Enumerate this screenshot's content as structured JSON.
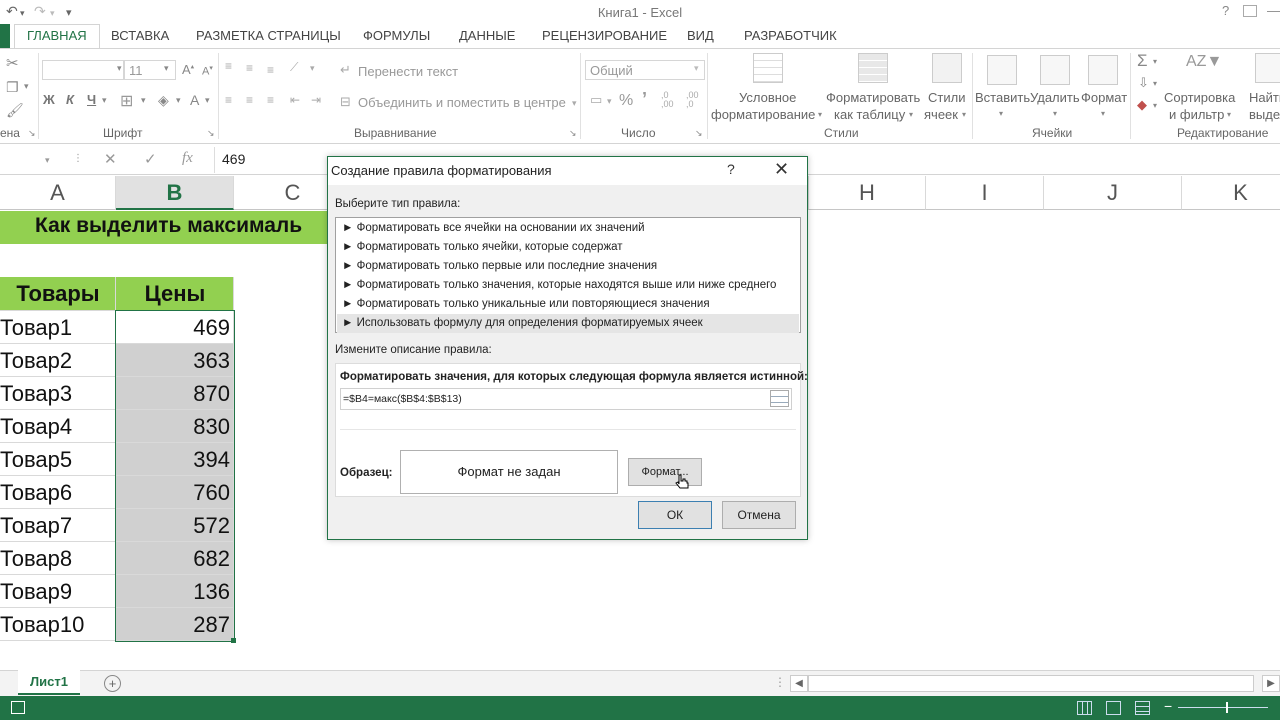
{
  "window": {
    "title": "Книга1 - Excel",
    "help": "?"
  },
  "tabs": [
    "ГЛАВНАЯ",
    "ВСТАВКА",
    "РАЗМЕТКА СТРАНИЦЫ",
    "ФОРМУЛЫ",
    "ДАННЫЕ",
    "РЕЦЕНЗИРОВАНИЕ",
    "ВИД",
    "РАЗРАБОТЧИК"
  ],
  "ribbon": {
    "font_size": "11",
    "bold": "Ж",
    "italic": "К",
    "underline": "Ч",
    "wrap_text": "Перенести текст",
    "merge_center": "Объединить и поместить в центре",
    "number_format": "Общий",
    "percent": "%",
    "comma": "’",
    "conditional_l1": "Условное",
    "conditional_l2": "форматирование",
    "format_table_l1": "Форматировать",
    "format_table_l2": "как таблицу",
    "styles_l1": "Стили",
    "styles_l2": "ячеек",
    "insert": "Вставить",
    "delete": "Удалить",
    "format": "Формат",
    "sort_l1": "Сортировка",
    "sort_l2": "и фильтр",
    "find_l1": "Найти",
    "find_l2": "выдел",
    "groups": {
      "clipboard": "ена",
      "font": "Шрифт",
      "alignment": "Выравнивание",
      "number": "Число",
      "styles": "Стили",
      "cells": "Ячейки",
      "editing": "Редактирование"
    }
  },
  "formula_bar": {
    "fx": "fx",
    "value": "469"
  },
  "columns": [
    "A",
    "B",
    "C",
    "H",
    "I",
    "J",
    "K"
  ],
  "sheet": {
    "title": "Как выделить максималь",
    "header_goods": "Товары",
    "header_prices": "Цены",
    "rows": [
      {
        "name": "Товар1",
        "price": "469"
      },
      {
        "name": "Товар2",
        "price": "363"
      },
      {
        "name": "Товар3",
        "price": "870"
      },
      {
        "name": "Товар4",
        "price": "830"
      },
      {
        "name": "Товар5",
        "price": "394"
      },
      {
        "name": "Товар6",
        "price": "760"
      },
      {
        "name": "Товар7",
        "price": "572"
      },
      {
        "name": "Товар8",
        "price": "682"
      },
      {
        "name": "Товар9",
        "price": "136"
      },
      {
        "name": "Товар10",
        "price": "287"
      }
    ]
  },
  "sheet_tab": "Лист1",
  "dialog": {
    "title": "Создание правила форматирования",
    "select_label": "Выберите тип правила:",
    "rules": [
      "► Форматировать все ячейки на основании их значений",
      "► Форматировать только ячейки, которые содержат",
      "► Форматировать только первые или последние значения",
      "► Форматировать только значения, которые находятся выше или ниже среднего",
      "► Форматировать только уникальные или повторяющиеся значения",
      "► Использовать формулу для определения форматируемых ячеек"
    ],
    "edit_label": "Измените описание правила:",
    "formula_label": "Форматировать значения, для которых следующая формула является истинной:",
    "formula": "=$B4=макс($B$4:$B$13)",
    "preview_label": "Образец:",
    "preview_text": "Формат не задан",
    "format_button": "Формат...",
    "ok": "ОК",
    "cancel": "Отмена"
  },
  "colors": {
    "excel_green": "#217346",
    "title_fill": "#92d050",
    "selected_fill": "#d0d0d0"
  }
}
